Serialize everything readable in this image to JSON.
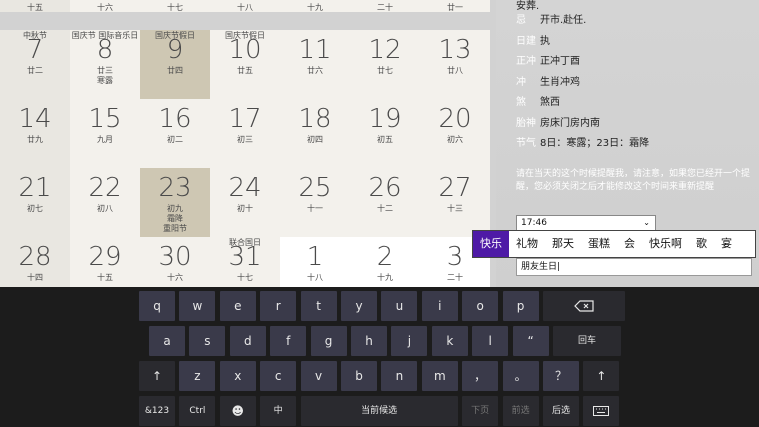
{
  "calendar": {
    "row0": [
      {
        "label": "十五"
      },
      {
        "label": "十六"
      },
      {
        "label": "十七"
      },
      {
        "label": "十八"
      },
      {
        "label": "十九"
      },
      {
        "label": "二十"
      },
      {
        "label": "廿一"
      }
    ],
    "rows": [
      [
        {
          "top": "中秋节",
          "num": "7",
          "lunar": "廿二",
          "sub": ""
        },
        {
          "top": "国庆节 国际音乐日",
          "num": "8",
          "lunar": "廿三",
          "sub": "寒露"
        },
        {
          "top": "国庆节假日",
          "num": "9",
          "lunar": "廿四",
          "sub": ""
        },
        {
          "top": "国庆节假日",
          "num": "10",
          "lunar": "廿五",
          "sub": ""
        },
        {
          "top": "",
          "num": "11",
          "lunar": "廿六",
          "sub": ""
        },
        {
          "top": "",
          "num": "12",
          "lunar": "廿七",
          "sub": ""
        },
        {
          "top": "",
          "num": "13",
          "lunar": "廿八",
          "sub": ""
        }
      ],
      [
        {
          "top": "",
          "num": "14",
          "lunar": "廿九",
          "sub": ""
        },
        {
          "top": "",
          "num": "15",
          "lunar": "九月",
          "sub": ""
        },
        {
          "top": "",
          "num": "16",
          "lunar": "初二",
          "sub": ""
        },
        {
          "top": "",
          "num": "17",
          "lunar": "初三",
          "sub": ""
        },
        {
          "top": "",
          "num": "18",
          "lunar": "初四",
          "sub": ""
        },
        {
          "top": "",
          "num": "19",
          "lunar": "初五",
          "sub": ""
        },
        {
          "top": "",
          "num": "20",
          "lunar": "初六",
          "sub": ""
        }
      ],
      [
        {
          "top": "",
          "num": "21",
          "lunar": "初七",
          "sub": ""
        },
        {
          "top": "",
          "num": "22",
          "lunar": "初八",
          "sub": ""
        },
        {
          "top": "",
          "num": "23",
          "lunar": "初九",
          "sub": "霜降",
          "sub2": "重阳节"
        },
        {
          "top": "",
          "num": "24",
          "lunar": "初十",
          "sub": ""
        },
        {
          "top": "",
          "num": "25",
          "lunar": "十一",
          "sub": ""
        },
        {
          "top": "",
          "num": "26",
          "lunar": "十二",
          "sub": ""
        },
        {
          "top": "",
          "num": "27",
          "lunar": "十三",
          "sub": ""
        }
      ],
      [
        {
          "top": "",
          "num": "28",
          "lunar": "十四",
          "sub": ""
        },
        {
          "top": "",
          "num": "29",
          "lunar": "十五",
          "sub": ""
        },
        {
          "top": "",
          "num": "30",
          "lunar": "十六",
          "sub": ""
        },
        {
          "top": "联合国日",
          "num": "31",
          "lunar": "十七",
          "sub": ""
        },
        {
          "top": "",
          "num": "1",
          "lunar": "十八",
          "sub": ""
        },
        {
          "top": "",
          "num": "2",
          "lunar": "十九",
          "sub": ""
        },
        {
          "top": "",
          "num": "3",
          "lunar": "二十",
          "sub": ""
        }
      ]
    ]
  },
  "panel": {
    "cut_top": "安葬.",
    "rows": [
      {
        "k": "忌",
        "v": "开市.赴任."
      },
      {
        "k": "日建",
        "v": "执"
      },
      {
        "k": "正冲",
        "v": "正冲丁酉"
      },
      {
        "k": "冲",
        "v": "生肖冲鸡"
      },
      {
        "k": "煞",
        "v": "煞西"
      },
      {
        "k": "胎神",
        "v": "房床门房内南"
      },
      {
        "k": "节气",
        "v": "8日：寒露；23日：霜降"
      }
    ],
    "reminder_text": "请在当天的这个时候提醒我，请注意，如果您已经开一个提醒，您必须关闭之后才能修改这个时间来重新提醒",
    "time_value": "17:46",
    "input_value": "朋友生日"
  },
  "candidates": [
    "快乐",
    "礼物",
    "那天",
    "蛋糕",
    "会",
    "快乐啊",
    "歌",
    "宴"
  ],
  "keyboard": {
    "row1": [
      "q",
      "w",
      "e",
      "r",
      "t",
      "y",
      "u",
      "i",
      "o",
      "p"
    ],
    "row2": [
      "a",
      "s",
      "d",
      "f",
      "g",
      "h",
      "j",
      "k",
      "l",
      "“"
    ],
    "row2_enter": "回车",
    "row3": [
      "z",
      "x",
      "c",
      "v",
      "b",
      "n",
      "m",
      "，",
      "。",
      "？"
    ],
    "bottom": {
      "k123": "&123",
      "ctrl": "Ctrl",
      "zh": "中",
      "space": "当前候选",
      "next": "下页",
      "prev_cand": "前选",
      "after_cand": "后选"
    }
  }
}
